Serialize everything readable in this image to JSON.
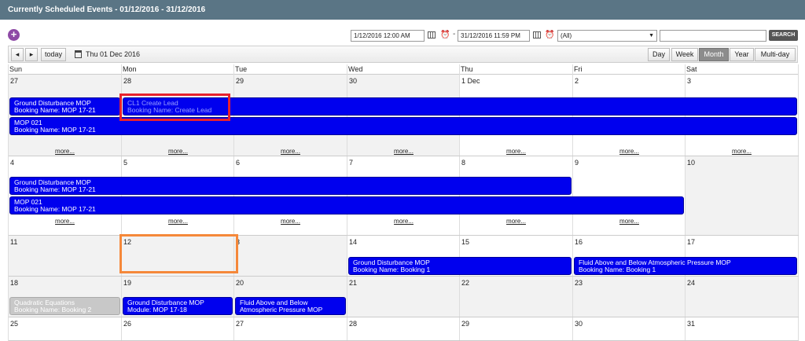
{
  "title": "Currently Scheduled Events - 01/12/2016 - 31/12/2016",
  "filters": {
    "start": "1/12/2016 12:00 AM",
    "end": "31/12/2016 11:59 PM",
    "dash": "-",
    "select_value": "(All)",
    "search_value": "",
    "search_label": "SEARCH"
  },
  "toolbar": {
    "prev": "◂",
    "next": "▸",
    "today": "today",
    "current_date": "Thu 01 Dec 2016",
    "views": [
      "Day",
      "Week",
      "Month",
      "Year",
      "Multi-day"
    ],
    "active_view": "Month"
  },
  "days_of_week": [
    "Sun",
    "Mon",
    "Tue",
    "Wed",
    "Thu",
    "Fri",
    "Sat"
  ],
  "more_label": "more...",
  "weeks": [
    {
      "days": [
        "27",
        "28",
        "29",
        "30",
        "1 Dec",
        "2",
        "3"
      ],
      "events": [
        {
          "line1": "Ground Disturbance MOP",
          "line2": "Booking Name: MOP 17-21"
        },
        {
          "line1": "CL1 Create Lead",
          "line2": "Booking Name: Create Lead"
        },
        {
          "line1": "MOP 021",
          "line2": "Booking Name: MOP 17-21"
        }
      ]
    },
    {
      "days": [
        "4",
        "5",
        "6",
        "7",
        "8",
        "9",
        "10"
      ],
      "events": [
        {
          "line1": "Ground Disturbance MOP",
          "line2": "Booking Name: MOP 17-21"
        },
        {
          "line1": "MOP 021",
          "line2": "Booking Name: MOP 17-21"
        }
      ]
    },
    {
      "days": [
        "11",
        "12",
        "3",
        "14",
        "15",
        "16",
        "17"
      ],
      "events": [
        {
          "line1": "Ground Disturbance MOP",
          "line2": "Booking Name: Booking 1"
        },
        {
          "line1": "Fluid Above and Below Atmospheric Pressure MOP",
          "line2": "Booking Name: Booking 1"
        }
      ]
    },
    {
      "days": [
        "18",
        "19",
        "20",
        "21",
        "22",
        "23",
        "24"
      ],
      "events": [
        {
          "line1": "Quadratic Equations",
          "line2": "Booking Name: Booking 2"
        },
        {
          "line1": "Ground Disturbance MOP",
          "line2": "Module: MOP 17-18"
        },
        {
          "line1": "Fluid Above and Below",
          "line2": "Atmospheric Pressure MOP"
        }
      ]
    },
    {
      "days": [
        "25",
        "26",
        "27",
        "28",
        "29",
        "30",
        "31"
      ],
      "events": []
    }
  ],
  "colors": {
    "titlebar": "#5a7585",
    "event": "#0000ee",
    "event_past": "#c8c8c8",
    "add_button": "#8e4aa6",
    "highlight_red": "#e8212d",
    "highlight_orange": "#f5883a"
  }
}
